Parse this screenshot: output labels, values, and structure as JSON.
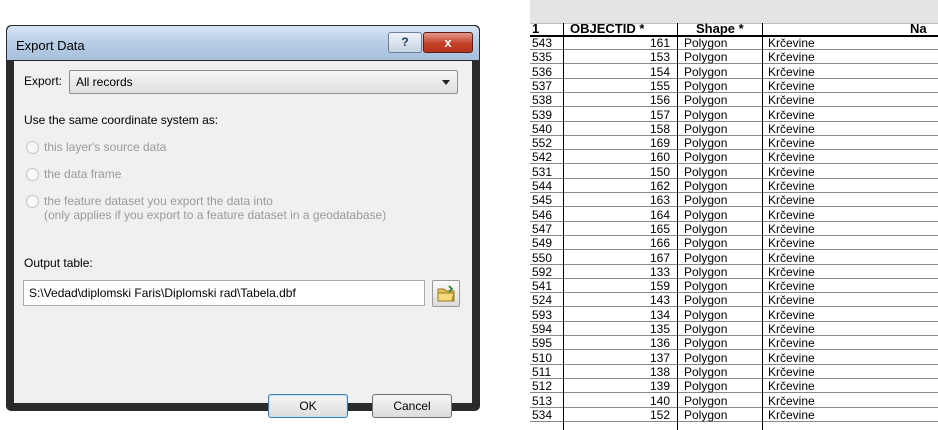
{
  "dialog": {
    "title": "Export Data",
    "help_label": "?",
    "close_label": "x",
    "export_label": "Export:",
    "export_value": "All records",
    "coord_label": "Use the same coordinate system as:",
    "radio_layer": "this layer's source data",
    "radio_frame": "the data frame",
    "radio_dataset_1": "the feature dataset you export the data into",
    "radio_dataset_2": "(only applies if you export to a feature dataset in a geodatabase)",
    "output_label": "Output table:",
    "output_value": "S:\\Vedad\\diplomski Faris\\Diplomski rad\\Tabela.dbf",
    "ok_label": "OK",
    "cancel_label": "Cancel",
    "folder_icon": "folder-icon"
  },
  "table": {
    "headers": {
      "index": "1",
      "objectid": "OBJECTID *",
      "shape": "Shape *",
      "name": "Na"
    },
    "rows": [
      {
        "idx": "543",
        "oid": "161",
        "shape": "Polygon",
        "name": "Krčevine"
      },
      {
        "idx": "535",
        "oid": "153",
        "shape": "Polygon",
        "name": "Krčevine"
      },
      {
        "idx": "536",
        "oid": "154",
        "shape": "Polygon",
        "name": "Krčevine"
      },
      {
        "idx": "537",
        "oid": "155",
        "shape": "Polygon",
        "name": "Krčevine"
      },
      {
        "idx": "538",
        "oid": "156",
        "shape": "Polygon",
        "name": "Krčevine"
      },
      {
        "idx": "539",
        "oid": "157",
        "shape": "Polygon",
        "name": "Krčevine"
      },
      {
        "idx": "540",
        "oid": "158",
        "shape": "Polygon",
        "name": "Krčevine"
      },
      {
        "idx": "552",
        "oid": "169",
        "shape": "Polygon",
        "name": "Krčevine"
      },
      {
        "idx": "542",
        "oid": "160",
        "shape": "Polygon",
        "name": "Krčevine"
      },
      {
        "idx": "531",
        "oid": "150",
        "shape": "Polygon",
        "name": "Krčevine"
      },
      {
        "idx": "544",
        "oid": "162",
        "shape": "Polygon",
        "name": "Krčevine"
      },
      {
        "idx": "545",
        "oid": "163",
        "shape": "Polygon",
        "name": "Krčevine"
      },
      {
        "idx": "546",
        "oid": "164",
        "shape": "Polygon",
        "name": "Krčevine"
      },
      {
        "idx": "547",
        "oid": "165",
        "shape": "Polygon",
        "name": "Krčevine"
      },
      {
        "idx": "549",
        "oid": "166",
        "shape": "Polygon",
        "name": "Krčevine"
      },
      {
        "idx": "550",
        "oid": "167",
        "shape": "Polygon",
        "name": "Krčevine"
      },
      {
        "idx": "592",
        "oid": "133",
        "shape": "Polygon",
        "name": "Krčevine"
      },
      {
        "idx": "541",
        "oid": "159",
        "shape": "Polygon",
        "name": "Krčevine"
      },
      {
        "idx": "524",
        "oid": "143",
        "shape": "Polygon",
        "name": "Krčevine"
      },
      {
        "idx": "593",
        "oid": "134",
        "shape": "Polygon",
        "name": "Krčevine"
      },
      {
        "idx": "594",
        "oid": "135",
        "shape": "Polygon",
        "name": "Krčevine"
      },
      {
        "idx": "595",
        "oid": "136",
        "shape": "Polygon",
        "name": "Krčevine"
      },
      {
        "idx": "510",
        "oid": "137",
        "shape": "Polygon",
        "name": "Krčevine"
      },
      {
        "idx": "511",
        "oid": "138",
        "shape": "Polygon",
        "name": "Krčevine"
      },
      {
        "idx": "512",
        "oid": "139",
        "shape": "Polygon",
        "name": "Krčevine"
      },
      {
        "idx": "513",
        "oid": "140",
        "shape": "Polygon",
        "name": "Krčevine"
      },
      {
        "idx": "534",
        "oid": "152",
        "shape": "Polygon",
        "name": "Krčevine"
      }
    ]
  }
}
